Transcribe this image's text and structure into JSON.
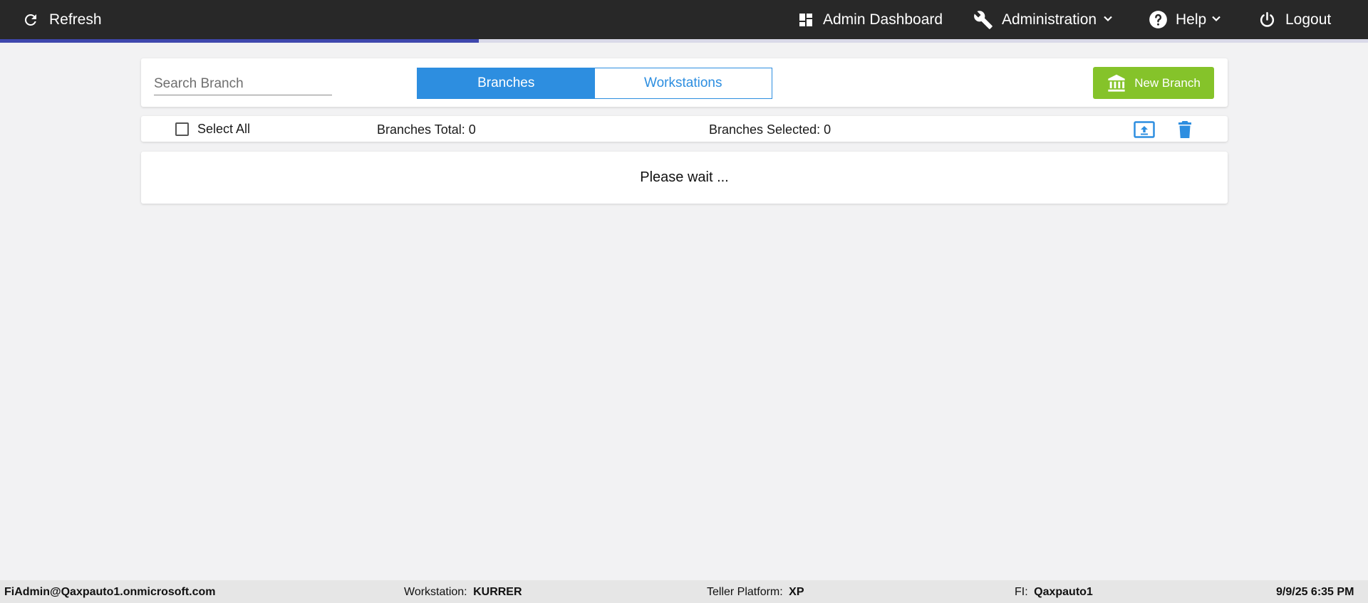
{
  "nav": {
    "refresh_label": "Refresh",
    "dashboard_label": "Admin Dashboard",
    "administration_label": "Administration",
    "help_label": "Help",
    "logout_label": "Logout"
  },
  "loading": {
    "progress_percent": 35
  },
  "toolbar": {
    "search_placeholder": "Search Branch",
    "search_value": "",
    "tabs": [
      {
        "label": "Branches",
        "active": true
      },
      {
        "label": "Workstations",
        "active": false
      }
    ],
    "new_branch_label": "New Branch"
  },
  "status": {
    "select_all_label": "Select All",
    "select_all_checked": false,
    "total_label": "Branches Total: 0",
    "selected_label": "Branches Selected: 0"
  },
  "content": {
    "message": "Please wait ..."
  },
  "footer": {
    "user": "FiAdmin@Qaxpauto1.onmicrosoft.com",
    "workstation_label": "Workstation:",
    "workstation_value": "KURRER",
    "platform_label": "Teller Platform:",
    "platform_value": "XP",
    "fi_label": "FI:",
    "fi_value": "Qaxpauto1",
    "datetime": "9/9/25 6:35 PM"
  },
  "colors": {
    "topbar": "#282828",
    "progress": "#3f47ad",
    "primary": "#2d8ee0",
    "success": "#85c32a",
    "background": "#f2f2f3"
  },
  "icons": {
    "refresh": "refresh-icon",
    "dashboard": "dashboard-grid-icon",
    "administration": "wrench-icon",
    "help": "help-circle-icon",
    "logout": "power-icon",
    "new_branch": "bank-icon",
    "upload": "upload-icon",
    "delete": "trash-icon"
  }
}
